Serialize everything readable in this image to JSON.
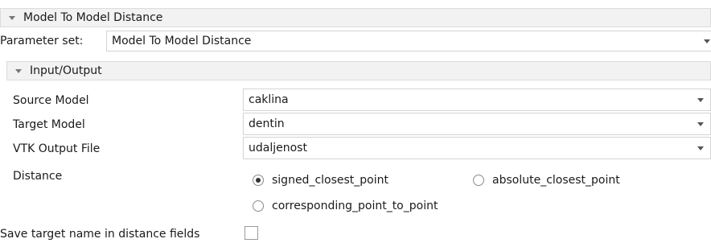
{
  "panel": {
    "title": "Model To Model Distance",
    "parameter_set_label": "Parameter set:",
    "parameter_set_value": "Model To Model Distance"
  },
  "io_section": {
    "title": "Input/Output"
  },
  "fields": {
    "source_model": {
      "label": "Source Model",
      "value": "caklina"
    },
    "target_model": {
      "label": "Target Model",
      "value": "dentin"
    },
    "vtk_output": {
      "label": "VTK Output File",
      "value": "udaljenost"
    }
  },
  "distance": {
    "label": "Distance",
    "options": [
      "signed_closest_point",
      "absolute_closest_point",
      "corresponding_point_to_point"
    ],
    "selected": "signed_closest_point"
  },
  "save_target": {
    "label": "Save target name in distance fields",
    "checked": false
  }
}
